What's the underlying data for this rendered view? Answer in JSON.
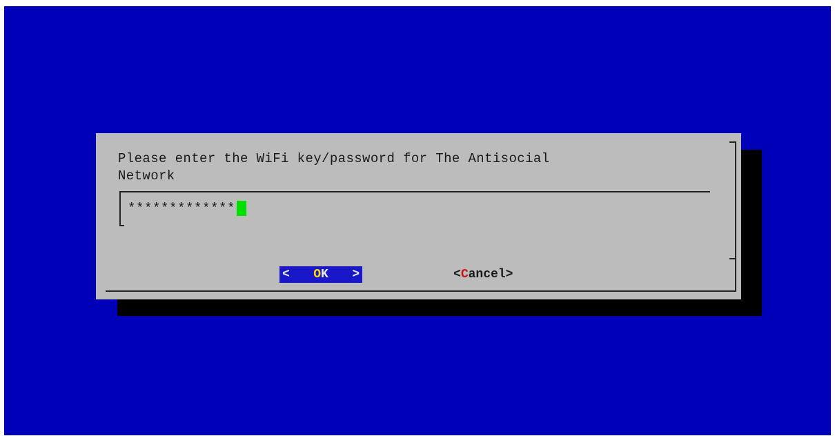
{
  "dialog": {
    "prompt": "Please enter the WiFi key/password for The Antisocial\nNetwork",
    "password_masked": "*************"
  },
  "buttons": {
    "ok": {
      "open": "<",
      "hotkey": "O",
      "rest": "K",
      "close": ">"
    },
    "cancel": {
      "open": "<",
      "hotkey": "C",
      "rest": "ancel",
      "close": ">"
    }
  },
  "colors": {
    "background": "#0000b8",
    "dialog": "#bcbcbc",
    "shadow": "#000000",
    "cursor": "#00e000",
    "selected_button": "#1818c8",
    "ok_hotkey": "#ffd800",
    "cancel_hotkey": "#c81414"
  }
}
